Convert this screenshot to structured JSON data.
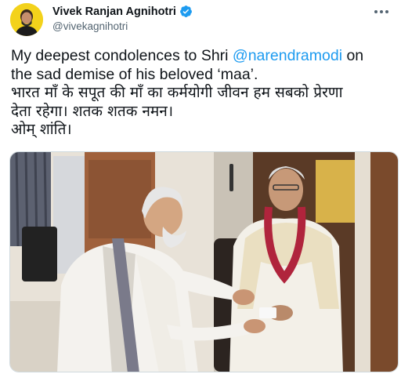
{
  "author": {
    "name": "Vivek Ranjan Agnihotri",
    "handle": "@vivekagnihotri",
    "avatar_icon": "avatar-portrait-icon",
    "verified_icon": "verified-badge-icon",
    "verified_color": "#1d9bf0"
  },
  "menu_icon": "more-options-icon",
  "tweet": {
    "line1_prefix": "My deepest condolences to Shri ",
    "line1_mention": "@narendramodi",
    "line1_suffix": " on",
    "line2": "the sad demise of his beloved ‘maa’.",
    "line3": "भारत माँ के सपूत की माँ का कर्मयोगी जीवन हम सबको प्रेरणा",
    "line4": "देता रहेगा। शतक शतक नमन।",
    "line5": "ओम् शांति।",
    "mention_color": "#1d9bf0"
  },
  "media": {
    "icon": "photo-icon"
  }
}
